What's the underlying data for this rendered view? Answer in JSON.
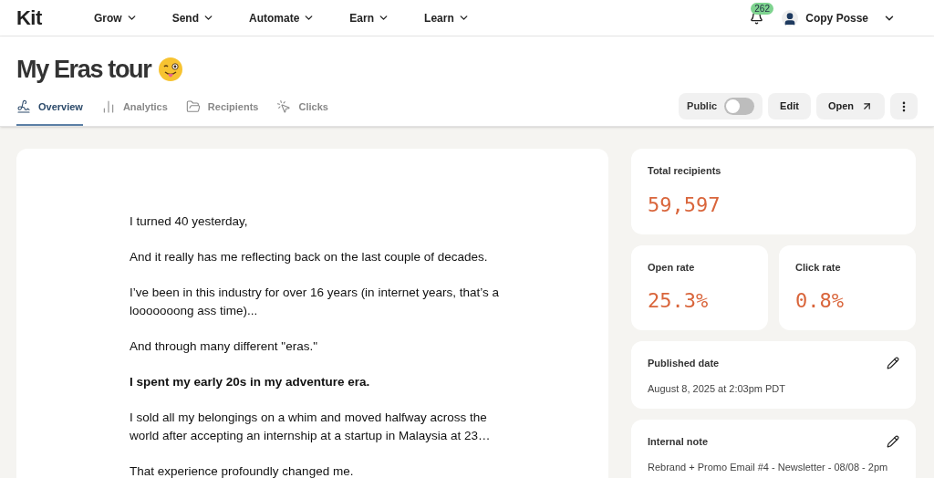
{
  "nav": {
    "logo": "Kit",
    "menus": [
      {
        "label": "Grow"
      },
      {
        "label": "Send"
      },
      {
        "label": "Automate"
      },
      {
        "label": "Earn"
      },
      {
        "label": "Learn"
      }
    ],
    "notifications": "262",
    "account": "Copy Posse"
  },
  "page": {
    "title": "My Eras tour"
  },
  "tabs": [
    {
      "label": "Overview",
      "kind": "overview",
      "selected": true
    },
    {
      "label": "Analytics",
      "kind": "analytics",
      "selected": false
    },
    {
      "label": "Recipients",
      "kind": "recipients",
      "selected": false
    },
    {
      "label": "Clicks",
      "kind": "clicks",
      "selected": false
    }
  ],
  "actions": {
    "public": {
      "label": "Public",
      "on": false
    },
    "edit": "Edit",
    "open": "Open"
  },
  "email": {
    "paragraphs": [
      {
        "kind": "normal",
        "text": "I turned 40 yesterday,"
      },
      {
        "kind": "normal",
        "text": "And it really has me reflecting back on the last couple of decades."
      },
      {
        "kind": "normal",
        "text": "I’ve been in this industry for over 16 years (in internet years, that’s a looooooong ass time)..."
      },
      {
        "kind": "normal",
        "text": "And through many different \"eras.\""
      },
      {
        "kind": "bold",
        "text": "I spent my early 20s in my adventure era."
      },
      {
        "kind": "normal",
        "text": "I sold all my belongings on a whim and moved halfway across the world after accepting an internship at a startup in Malaysia at 23…"
      },
      {
        "kind": "normal",
        "text": "That experience profoundly changed me."
      }
    ]
  },
  "stats": {
    "total": {
      "label": "Total recipients",
      "value": "59,597"
    },
    "open": {
      "label": "Open rate",
      "value": "25.3%"
    },
    "click": {
      "label": "Click rate",
      "value": "0.8%"
    }
  },
  "details": [
    {
      "label": "Published date",
      "value": "August 8, 2025 at 2:03pm PDT"
    },
    {
      "label": "Internal note",
      "value": "Rebrand + Promo Email #4 - Newsletter - 08/08 - 2pm"
    }
  ]
}
